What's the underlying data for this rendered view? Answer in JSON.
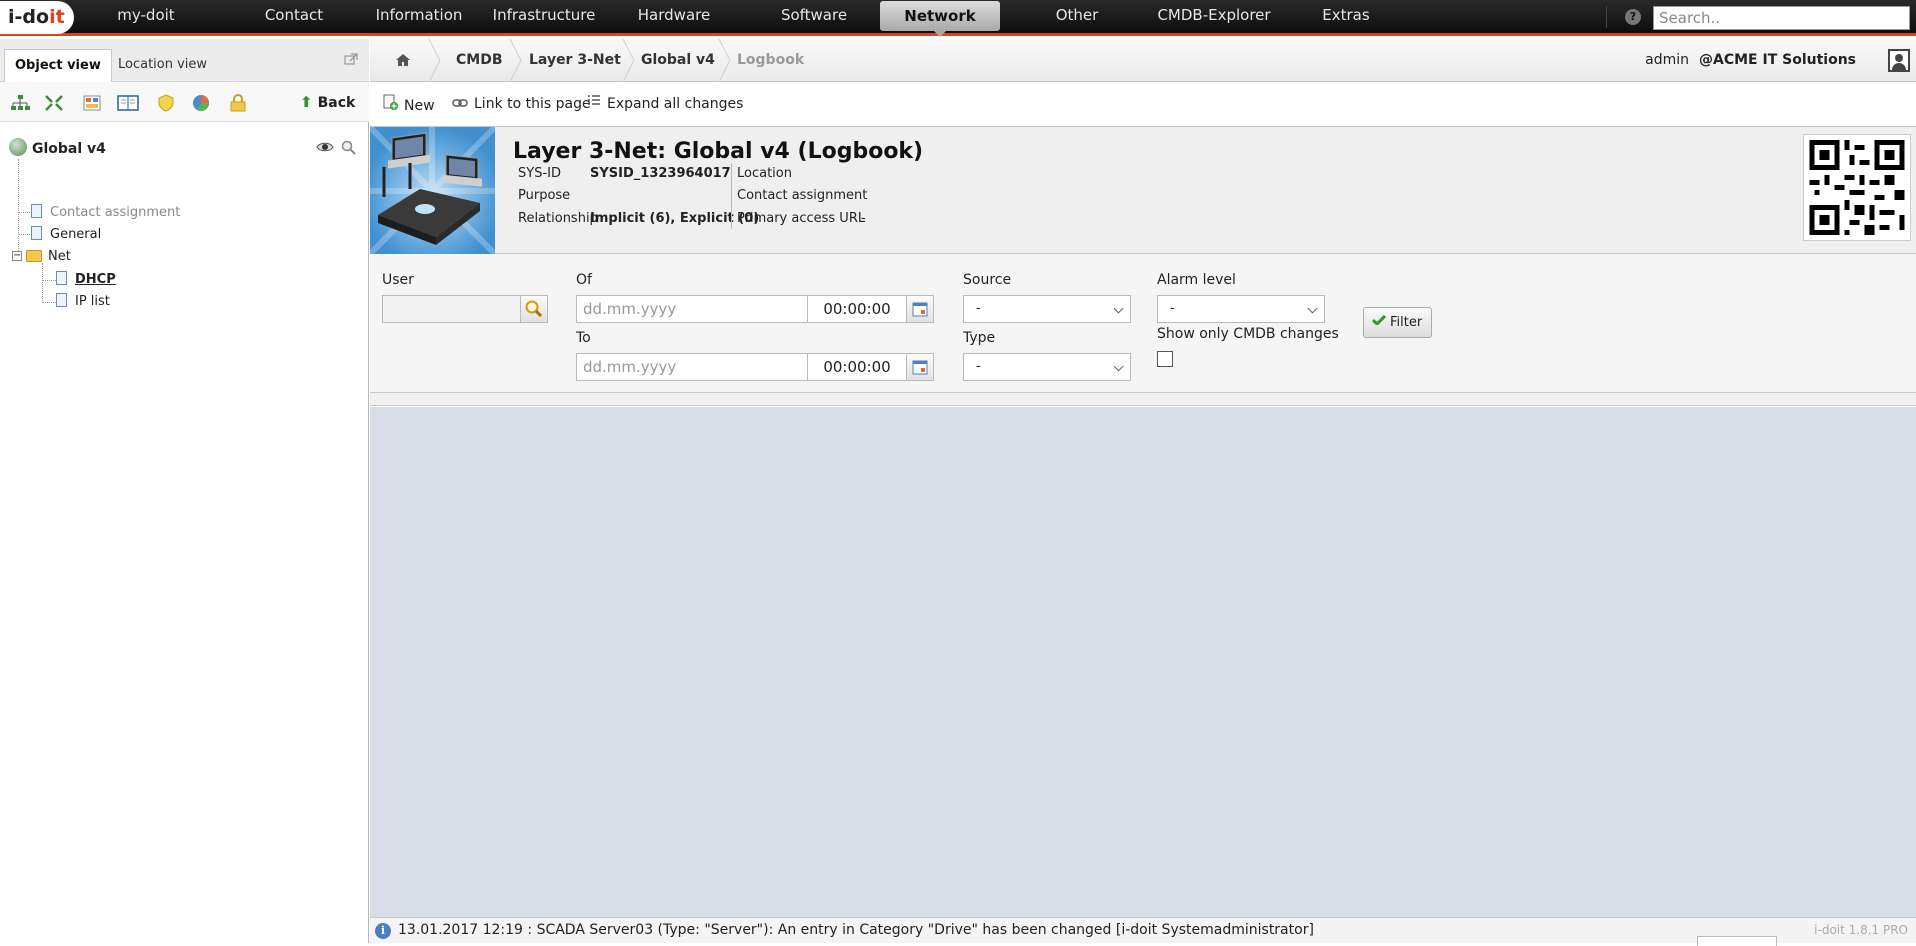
{
  "app": {
    "logo_main": "i-do",
    "logo_accent": "it"
  },
  "nav": {
    "items": [
      "my-doit",
      "Contact",
      "Information",
      "Infrastructure",
      "Hardware",
      "Software",
      "Network",
      "Other",
      "CMDB-Explorer",
      "Extras"
    ],
    "active": "Network",
    "search_placeholder": "Search.."
  },
  "left": {
    "tabs": [
      "Object view",
      "Location view"
    ],
    "back_label": "Back",
    "tree": {
      "root": "Global v4",
      "items": [
        "Contact assignment",
        "General",
        "Net",
        "DHCP",
        "IP list"
      ]
    }
  },
  "breadcrumb": [
    "CMDB",
    "Layer 3-Net",
    "Global v4",
    "Logbook"
  ],
  "user": {
    "name": "admin",
    "tenant": "@ACME IT Solutions"
  },
  "actions": {
    "new": "New",
    "link": "Link to this page",
    "expand": "Expand all changes"
  },
  "object": {
    "title": "Layer 3-Net: Global v4 (Logbook)",
    "sysid_label": "SYS-ID",
    "sysid_value": "SYSID_1323964017",
    "purpose_label": "Purpose",
    "relationship_label": "Relationship",
    "relationship_value": "Implicit (6), Explicit (0)",
    "location_label": "Location",
    "contact_label": "Contact assignment",
    "url_label": "Primary access URL",
    "url_value": "-"
  },
  "filter": {
    "user_label": "User",
    "of_label": "Of",
    "to_label": "To",
    "date_placeholder": "dd.mm.yyyy",
    "time_value": "00:00:00",
    "source_label": "Source",
    "source_value": "-",
    "type_label": "Type",
    "type_value": "-",
    "alarm_label": "Alarm level",
    "alarm_value": "-",
    "cmdb_only_label": "Show only CMDB changes",
    "cmdb_only_checked": false,
    "filter_button": "Filter"
  },
  "status": {
    "message": "13.01.2017 12:19 : SCADA Server03 (Type: \"Server\"): An entry in Category \"Drive\" has been changed [i-doit Systemadministrator]",
    "version": "i-doit 1.8.1 PRO"
  }
}
